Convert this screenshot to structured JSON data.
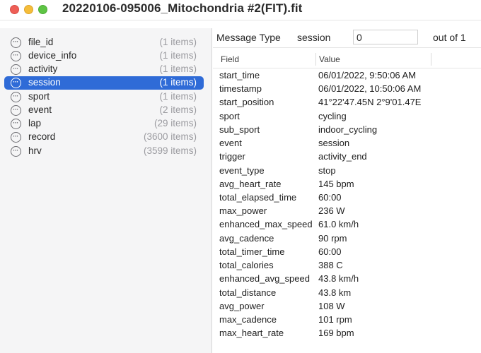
{
  "window": {
    "title": "20220106-095006_Mitochondria #2(FIT).fit"
  },
  "sidebar": {
    "items": [
      {
        "label": "file_id",
        "count": "(1 items)"
      },
      {
        "label": "device_info",
        "count": "(1 items)"
      },
      {
        "label": "activity",
        "count": "(1 items)"
      },
      {
        "label": "session",
        "count": "(1 items)"
      },
      {
        "label": "sport",
        "count": "(1 items)"
      },
      {
        "label": "event",
        "count": "(2 items)"
      },
      {
        "label": "lap",
        "count": "(29 items)"
      },
      {
        "label": "record",
        "count": "(3600 items)"
      },
      {
        "label": "hrv",
        "count": "(3599 items)"
      }
    ],
    "selected": "session",
    "icon": "more-circle-icon"
  },
  "toolbar": {
    "message_type_label": "Message Type",
    "message_type_value": "session",
    "index_value": "0",
    "out_of_label": "out of 1"
  },
  "table": {
    "columns": {
      "field": "Field",
      "value": "Value"
    },
    "rows": [
      {
        "field": "start_time",
        "value": "06/01/2022, 9:50:06 AM"
      },
      {
        "field": "timestamp",
        "value": "06/01/2022, 10:50:06 AM"
      },
      {
        "field": "start_position",
        "value": "41°22'47.45N 2°9'01.47E"
      },
      {
        "field": "sport",
        "value": "cycling"
      },
      {
        "field": "sub_sport",
        "value": "indoor_cycling"
      },
      {
        "field": "event",
        "value": "session"
      },
      {
        "field": "trigger",
        "value": "activity_end"
      },
      {
        "field": "event_type",
        "value": "stop"
      },
      {
        "field": "avg_heart_rate",
        "value": "145 bpm"
      },
      {
        "field": "total_elapsed_time",
        "value": "60:00"
      },
      {
        "field": "max_power",
        "value": "236 W"
      },
      {
        "field": "enhanced_max_speed",
        "value": "61.0 km/h"
      },
      {
        "field": "avg_cadence",
        "value": "90 rpm"
      },
      {
        "field": "total_timer_time",
        "value": "60:00"
      },
      {
        "field": "total_calories",
        "value": "388 C"
      },
      {
        "field": "enhanced_avg_speed",
        "value": "43.8 km/h"
      },
      {
        "field": "total_distance",
        "value": "43.8 km"
      },
      {
        "field": "avg_power",
        "value": "108 W"
      },
      {
        "field": "max_cadence",
        "value": "101 rpm"
      },
      {
        "field": "max_heart_rate",
        "value": "169 bpm"
      }
    ]
  }
}
